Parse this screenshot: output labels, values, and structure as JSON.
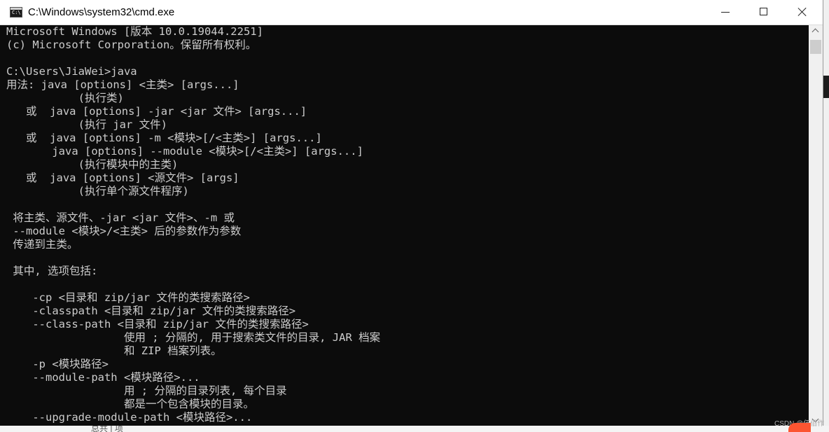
{
  "window": {
    "title": "C:\\Windows\\system32\\cmd.exe",
    "icon": "cmd-icon",
    "icon_glyph": "C:\\",
    "controls": {
      "minimize": "minimize-icon",
      "maximize": "maximize-icon",
      "close": "close-icon"
    }
  },
  "console": {
    "foreground": "#cccccc",
    "background": "#0c0c0c",
    "lines": [
      "Microsoft Windows [版本 10.0.19044.2251]",
      "(c) Microsoft Corporation。保留所有权利。",
      "",
      "C:\\Users\\JiaWei>java",
      "用法: java [options] <主类> [args...]",
      "           (执行类)",
      "   或  java [options] -jar <jar 文件> [args...]",
      "           (执行 jar 文件)",
      "   或  java [options] -m <模块>[/<主类>] [args...]",
      "       java [options] --module <模块>[/<主类>] [args...]",
      "           (执行模块中的主类)",
      "   或  java [options] <源文件> [args]",
      "           (执行单个源文件程序)",
      "",
      " 将主类、源文件、-jar <jar 文件>、-m 或",
      " --module <模块>/<主类> 后的参数作为参数",
      " 传递到主类。",
      "",
      " 其中, 选项包括:",
      "",
      "    -cp <目录和 zip/jar 文件的类搜索路径>",
      "    -classpath <目录和 zip/jar 文件的类搜索路径>",
      "    --class-path <目录和 zip/jar 文件的类搜索路径>",
      "                  使用 ; 分隔的, 用于搜索类文件的目录, JAR 档案",
      "                  和 ZIP 档案列表。",
      "    -p <模块路径>",
      "    --module-path <模块路径>...",
      "                  用 ; 分隔的目录列表, 每个目录",
      "                  都是一个包含模块的目录。",
      "    --upgrade-module-path <模块路径>..."
    ]
  },
  "scrollbar": {
    "up": "chevron-up-icon",
    "down": "chevron-down-icon"
  },
  "desktop": {
    "partial_text": "总共 | 项"
  },
  "watermark": "CSDN @伍佰作"
}
